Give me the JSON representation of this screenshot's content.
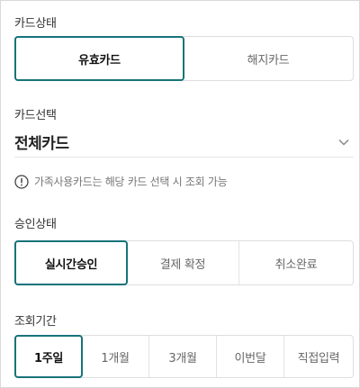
{
  "card_status": {
    "label": "카드상태",
    "options": [
      "유효카드",
      "해지카드"
    ],
    "selected": "유효카드"
  },
  "card_select": {
    "label": "카드선택",
    "value": "전체카드",
    "chevron_icon": "chevron-down-icon"
  },
  "notice": {
    "icon": "info-circle-icon",
    "text": "가족사용카드는 해당 카드 선택 시 조회 가능"
  },
  "approval_status": {
    "label": "승인상태",
    "options": [
      "실시간승인",
      "결제 확정",
      "취소완료"
    ],
    "selected": "실시간승인"
  },
  "period": {
    "label": "조회기간",
    "options": [
      "1주일",
      "1개월",
      "3개월",
      "이번달",
      "직접입력"
    ],
    "selected": "1주일"
  },
  "colors": {
    "accent": "#17737a",
    "border": "#dedede",
    "muted_text": "#666666"
  }
}
